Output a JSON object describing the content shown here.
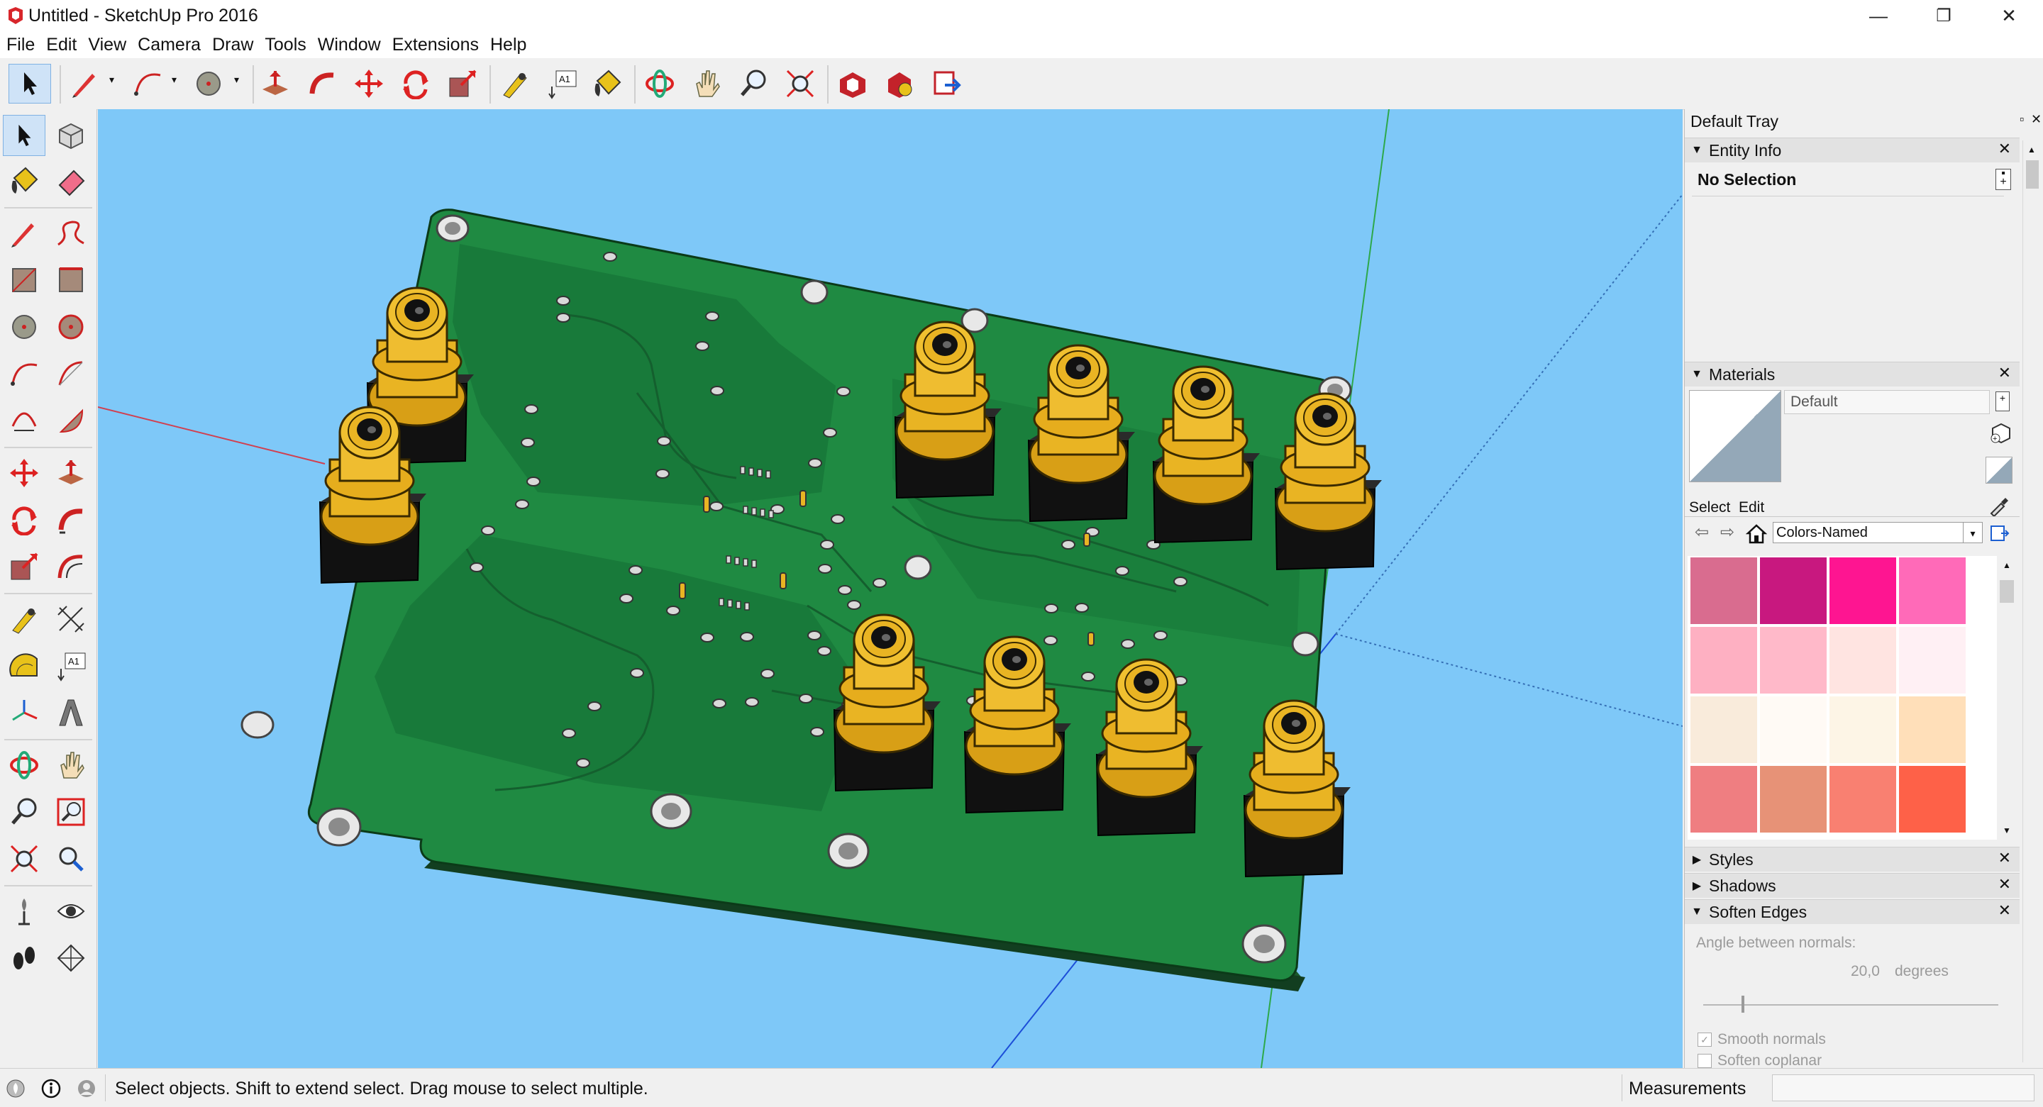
{
  "window": {
    "title": "Untitled - SketchUp Pro 2016",
    "controls": {
      "minimize": "—",
      "maximize": "❐",
      "close": "✕"
    }
  },
  "menu": [
    "File",
    "Edit",
    "View",
    "Camera",
    "Draw",
    "Tools",
    "Window",
    "Extensions",
    "Help"
  ],
  "toolbar": {
    "tools": [
      {
        "name": "select-icon"
      },
      {
        "name": "pencil-icon"
      },
      {
        "name": "arc-icon"
      },
      {
        "name": "circle-icon"
      },
      {
        "name": "push-pull-icon"
      },
      {
        "name": "follow-me-icon"
      },
      {
        "name": "move-icon"
      },
      {
        "name": "rotate-icon"
      },
      {
        "name": "scale-icon"
      },
      {
        "name": "tape-measure-icon"
      },
      {
        "name": "text-icon"
      },
      {
        "name": "paint-bucket-icon"
      },
      {
        "name": "orbit-icon"
      },
      {
        "name": "pan-icon"
      },
      {
        "name": "zoom-icon"
      },
      {
        "name": "zoom-extents-icon"
      },
      {
        "name": "warehouse-icon"
      },
      {
        "name": "extension-warehouse-icon"
      },
      {
        "name": "layout-send-icon"
      }
    ],
    "text_tool_label": "A1"
  },
  "leftbar": {
    "text_tool_label": "A1",
    "tools": [
      "select-icon",
      "make-component-icon",
      "paint-bucket-icon",
      "eraser-icon",
      "pencil-icon",
      "freehand-icon",
      "rectangle-icon",
      "rotated-rectangle-icon",
      "circle-icon",
      "polygon-icon",
      "arc-icon",
      "two-point-arc-icon",
      "three-point-arc-icon",
      "pie-icon",
      "move-icon",
      "push-pull-icon",
      "rotate-icon",
      "follow-me-icon",
      "scale-icon",
      "offset-icon",
      "tape-measure-icon",
      "dimension-icon",
      "protractor-icon",
      "text-icon",
      "axes-icon",
      "3d-text-icon",
      "orbit-icon",
      "pan-icon",
      "zoom-icon",
      "zoom-window-icon",
      "zoom-extents-icon",
      "previous-view-icon",
      "position-camera-icon",
      "look-around-icon",
      "walk-icon",
      "section-plane-icon"
    ]
  },
  "tray": {
    "title": "Default Tray",
    "entity_info": {
      "label": "Entity Info",
      "selection": "No Selection"
    },
    "materials": {
      "label": "Materials",
      "material_name": "Default",
      "tabs": [
        "Select",
        "Edit"
      ],
      "library": "Colors-Named",
      "swatches": [
        "#d96c8f",
        "#c8187f",
        "#fe1591",
        "#ff6ab8",
        "#feb0c2",
        "#ffb9c9",
        "#ffe4e1",
        "#fff0f4",
        "#f9ebdb",
        "#fffaf5",
        "#fdf5e6",
        "#ffdfb9",
        "#ef7e81",
        "#e79277",
        "#f98071",
        "#fe6148"
      ]
    },
    "styles": {
      "label": "Styles"
    },
    "shadows": {
      "label": "Shadows"
    },
    "soften_edges": {
      "label": "Soften Edges",
      "angle_label": "Angle between normals:",
      "angle_value": "20,0",
      "angle_unit": "degrees",
      "smooth_normals": "Smooth normals",
      "soften_coplanar": "Soften coplanar"
    }
  },
  "status": {
    "message": "Select objects. Shift to extend select. Drag mouse to select multiple.",
    "measurements_label": "Measurements"
  },
  "colors": {
    "sky": "#7ec8f8",
    "pcb": "#1f8a42",
    "connector_gold": "#e9b423",
    "selection_blue": "#cfe3f7"
  }
}
